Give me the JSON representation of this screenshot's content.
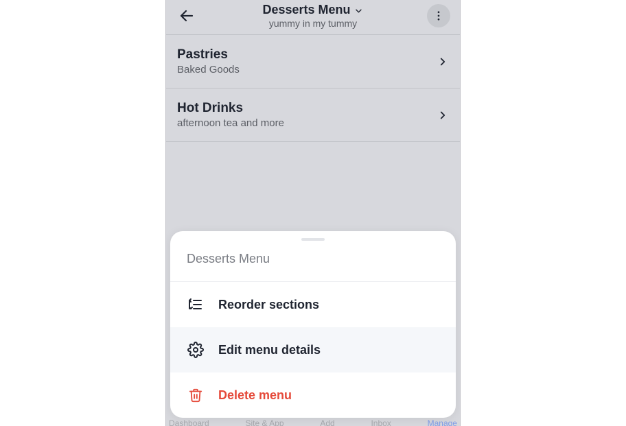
{
  "header": {
    "title": "Desserts Menu",
    "subtitle": "yummy in my tummy"
  },
  "sections": [
    {
      "title": "Pastries",
      "subtitle": "Baked Goods"
    },
    {
      "title": "Hot Drinks",
      "subtitle": "afternoon tea and more"
    }
  ],
  "sheet": {
    "title": "Desserts Menu",
    "items": [
      {
        "label": "Reorder sections"
      },
      {
        "label": "Edit menu details"
      },
      {
        "label": "Delete menu"
      }
    ]
  },
  "bottom_nav": {
    "items": [
      "Dashboard",
      "Site & App",
      "Add",
      "Inbox",
      "Manage"
    ]
  }
}
